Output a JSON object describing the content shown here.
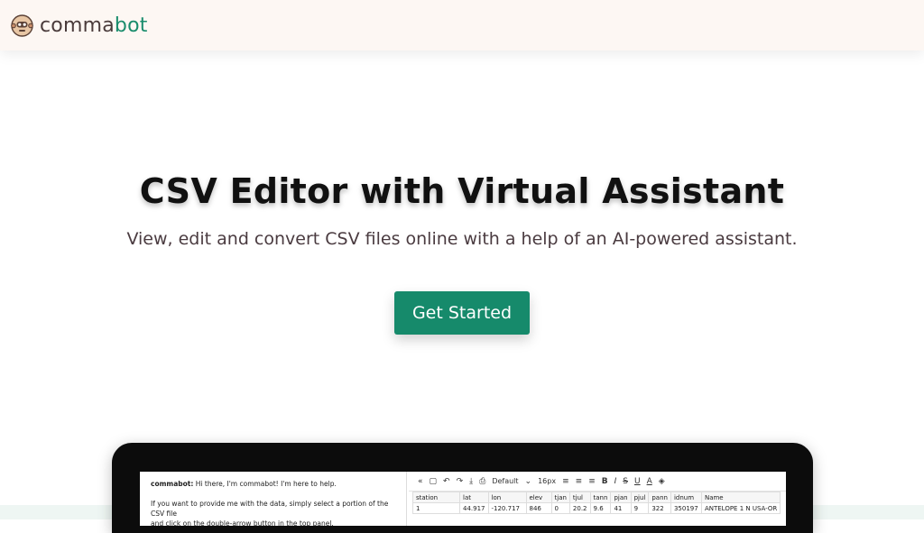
{
  "header": {
    "logo_left": "comma",
    "logo_right": "bot"
  },
  "hero": {
    "title": "CSV Editor with Virtual Assistant",
    "subtitle": "View, edit and convert CSV files online with a help of an AI-powered assistant.",
    "cta_label": "Get Started"
  },
  "colors": {
    "accent": "#198c6c",
    "button": "#168a6b",
    "header_bg": "#fdf7f3"
  },
  "preview": {
    "chat": {
      "sender": "commabot:",
      "greeting": "Hi there, I'm commabot! I'm here to help.",
      "line2": "If you want to provide me with the data, simply select a portion of the CSV file",
      "line3": "and click on the double-arrow button in the top panel."
    },
    "toolbar": {
      "collapse": "«",
      "font": "Default",
      "font_size": "16px"
    },
    "table": {
      "headers": [
        "station",
        "lat",
        "lon",
        "elev",
        "tjan",
        "tjul",
        "tann",
        "pjan",
        "pjul",
        "pann",
        "idnum",
        "Name"
      ],
      "row1": [
        "1",
        "44.917",
        "-120.717",
        "846",
        "0",
        "20.2",
        "9.6",
        "41",
        "9",
        "322",
        "350197",
        "ANTELOPE 1 N USA-OR"
      ]
    }
  }
}
